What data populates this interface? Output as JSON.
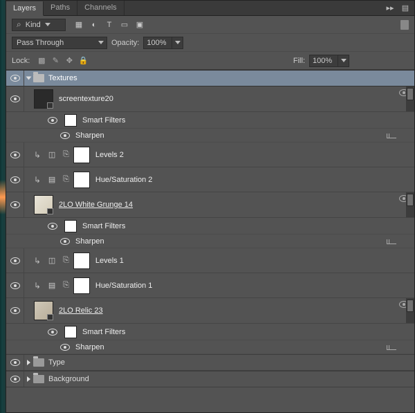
{
  "tabs": [
    "Layers",
    "Paths",
    "Channels"
  ],
  "activeTab": 0,
  "filter": {
    "kind": "Kind"
  },
  "blend": {
    "mode": "Pass Through",
    "opacityLabel": "Opacity:",
    "opacity": "100%"
  },
  "lock": {
    "label": "Lock:",
    "fillLabel": "Fill:",
    "fill": "100%"
  },
  "groups": {
    "textures": "Textures",
    "type": "Type",
    "background": "Background"
  },
  "layers": {
    "l1": {
      "name": "screentexture20"
    },
    "sf": "Smart Filters",
    "sharpen": "Sharpen",
    "lv2": "Levels 2",
    "hs2": "Hue/Saturation 2",
    "l2": {
      "name": "2LO White Grunge 14"
    },
    "lv1": "Levels 1",
    "hs1": "Hue/Saturation 1",
    "l3": {
      "name": "2LO Relic 23"
    }
  }
}
